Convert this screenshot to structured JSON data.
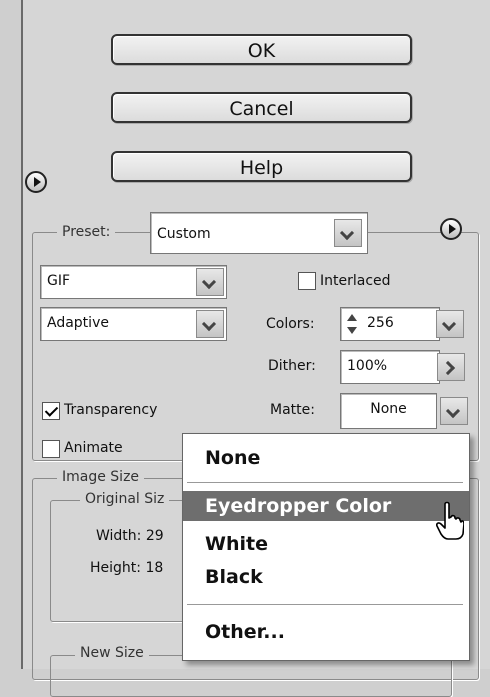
{
  "buttons": {
    "ok": "OK",
    "cancel": "Cancel",
    "help": "Help"
  },
  "preset": {
    "label": "Preset:",
    "value": "Custom"
  },
  "format": {
    "value": "GIF"
  },
  "reduction": {
    "value": "Adaptive"
  },
  "interlaced": {
    "label": "Interlaced",
    "checked": false
  },
  "colors": {
    "label": "Colors:",
    "value": "256"
  },
  "dither": {
    "label": "Dither:",
    "value": "100%"
  },
  "matte": {
    "label": "Matte:",
    "value": "None"
  },
  "transparency": {
    "label": "Transparency",
    "checked": true
  },
  "animate": {
    "label": "Animate",
    "checked": false
  },
  "image_size": {
    "legend": "Image Size",
    "original": "Original Siz",
    "width_label": "Width: 29",
    "height_label": "Height: 18",
    "new_size": "New Size"
  },
  "matte_menu": {
    "items": [
      "None",
      "Eyedropper Color",
      "White",
      "Black",
      "Other..."
    ],
    "selected": "Eyedropper Color"
  }
}
